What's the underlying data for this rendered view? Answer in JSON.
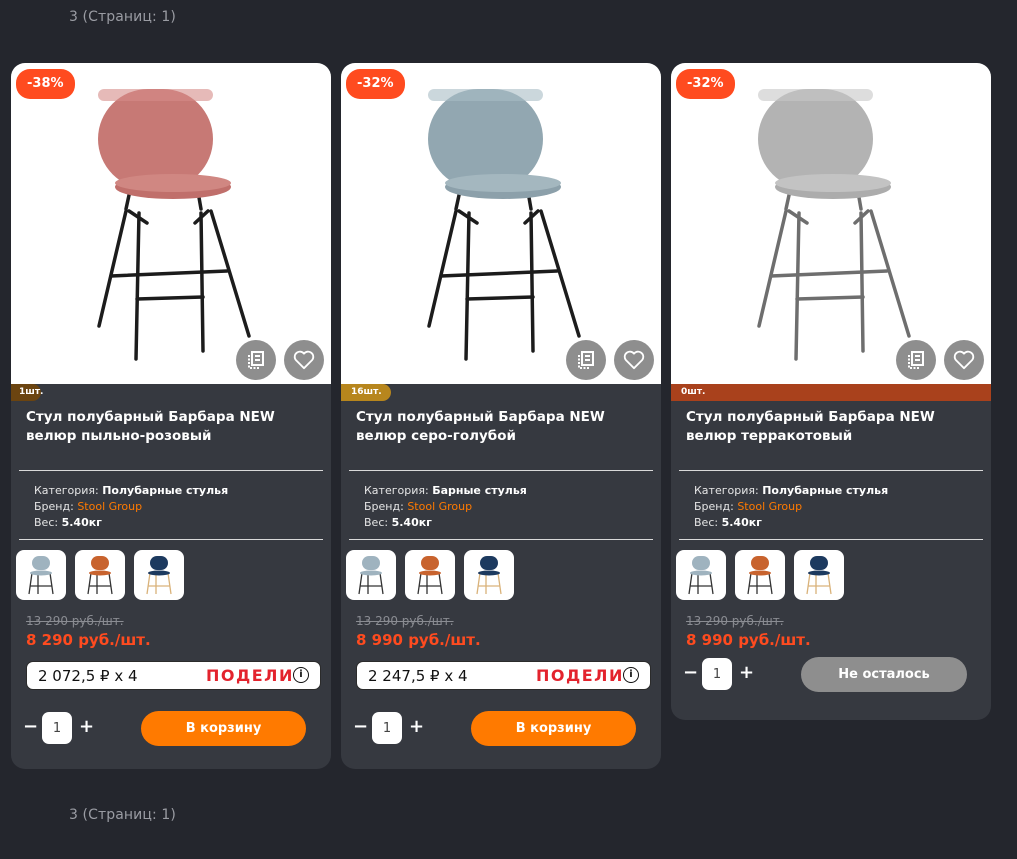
{
  "pagination": {
    "top": "3 (Страниц: 1)",
    "bottom": "3 (Страниц: 1)"
  },
  "labels": {
    "category": "Категория:",
    "brand": "Бренд:",
    "weight": "Вес:",
    "add_to_cart": "В корзину",
    "sold_out": "Не осталось",
    "minus": "−",
    "plus": "+",
    "podeli_logo": "ПОДЕЛИ",
    "podeli_info": "i"
  },
  "colors": {
    "accent": "#ff7a00",
    "discount": "#ff4b1f",
    "card_bg": "#363940",
    "page_bg": "#24262d"
  },
  "products": [
    {
      "discount": "-38%",
      "stock": "1шт.",
      "title": "Стул полубарный Барбара NEW велюр пыльно-розовый",
      "category": "Полубарные стулья",
      "brand": "Stool Group",
      "weight": "5.40кг",
      "old_price": "13 290 руб./шт.",
      "price": "8 290 руб./шт.",
      "installment": "2 072,5 ₽ x 4",
      "quantity": "1",
      "swatches": [
        "grey-blue",
        "terracotta",
        "navy"
      ]
    },
    {
      "discount": "-32%",
      "stock": "16шт.",
      "title": "Стул полубарный Барбара NEW велюр серо-голубой",
      "category": "Барные стулья",
      "brand": "Stool Group",
      "weight": "5.40кг",
      "old_price": "13 290 руб./шт.",
      "price": "8 990 руб./шт.",
      "installment": "2 247,5 ₽ x 4",
      "quantity": "1",
      "swatches": [
        "grey-blue",
        "terracotta",
        "navy"
      ]
    },
    {
      "discount": "-32%",
      "stock": "0шт.",
      "title": "Стул полубарный Барбара NEW велюр терракотовый",
      "category": "Полубарные стулья",
      "brand": "Stool Group",
      "weight": "5.40кг",
      "old_price": "13 290 руб./шт.",
      "price": "8 990 руб./шт.",
      "quantity": "1",
      "swatches": [
        "grey-blue",
        "terracotta",
        "navy"
      ]
    }
  ]
}
